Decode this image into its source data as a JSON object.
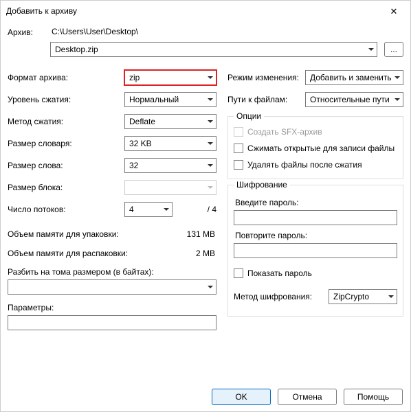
{
  "window": {
    "title": "Добавить к архиву",
    "close": "✕"
  },
  "archive": {
    "label": "Архив:",
    "path": "C:\\Users\\User\\Desktop\\",
    "filename": "Desktop.zip",
    "browse": "..."
  },
  "left": {
    "format_label": "Формат архива:",
    "format_value": "zip",
    "level_label": "Уровень сжатия:",
    "level_value": "Нормальный",
    "method_label": "Метод сжатия:",
    "method_value": "Deflate",
    "dict_label": "Размер словаря:",
    "dict_value": "32 KB",
    "word_label": "Размер слова:",
    "word_value": "32",
    "block_label": "Размер блока:",
    "block_value": "",
    "threads_label": "Число потоков:",
    "threads_value": "4",
    "threads_total": "/ 4",
    "mem_pack_label": "Объем памяти для упаковки:",
    "mem_pack_value": "131 MB",
    "mem_unpack_label": "Объем памяти для распаковки:",
    "mem_unpack_value": "2 MB",
    "split_label": "Разбить на тома размером (в байтах):",
    "split_value": "",
    "params_label": "Параметры:",
    "params_value": ""
  },
  "right": {
    "update_label": "Режим изменения:",
    "update_value": "Добавить и заменить",
    "paths_label": "Пути к файлам:",
    "paths_value": "Относительные пути",
    "options_legend": "Опции",
    "opt_sfx": "Создать SFX-архив",
    "opt_compress_open": "Сжимать открытые для записи файлы",
    "opt_delete_after": "Удалять файлы после сжатия",
    "enc_legend": "Шифрование",
    "pass_label": "Введите пароль:",
    "pass2_label": "Повторите пароль:",
    "show_pass": "Показать пароль",
    "enc_method_label": "Метод шифрования:",
    "enc_method_value": "ZipCrypto"
  },
  "buttons": {
    "ok": "OK",
    "cancel": "Отмена",
    "help": "Помощь"
  }
}
